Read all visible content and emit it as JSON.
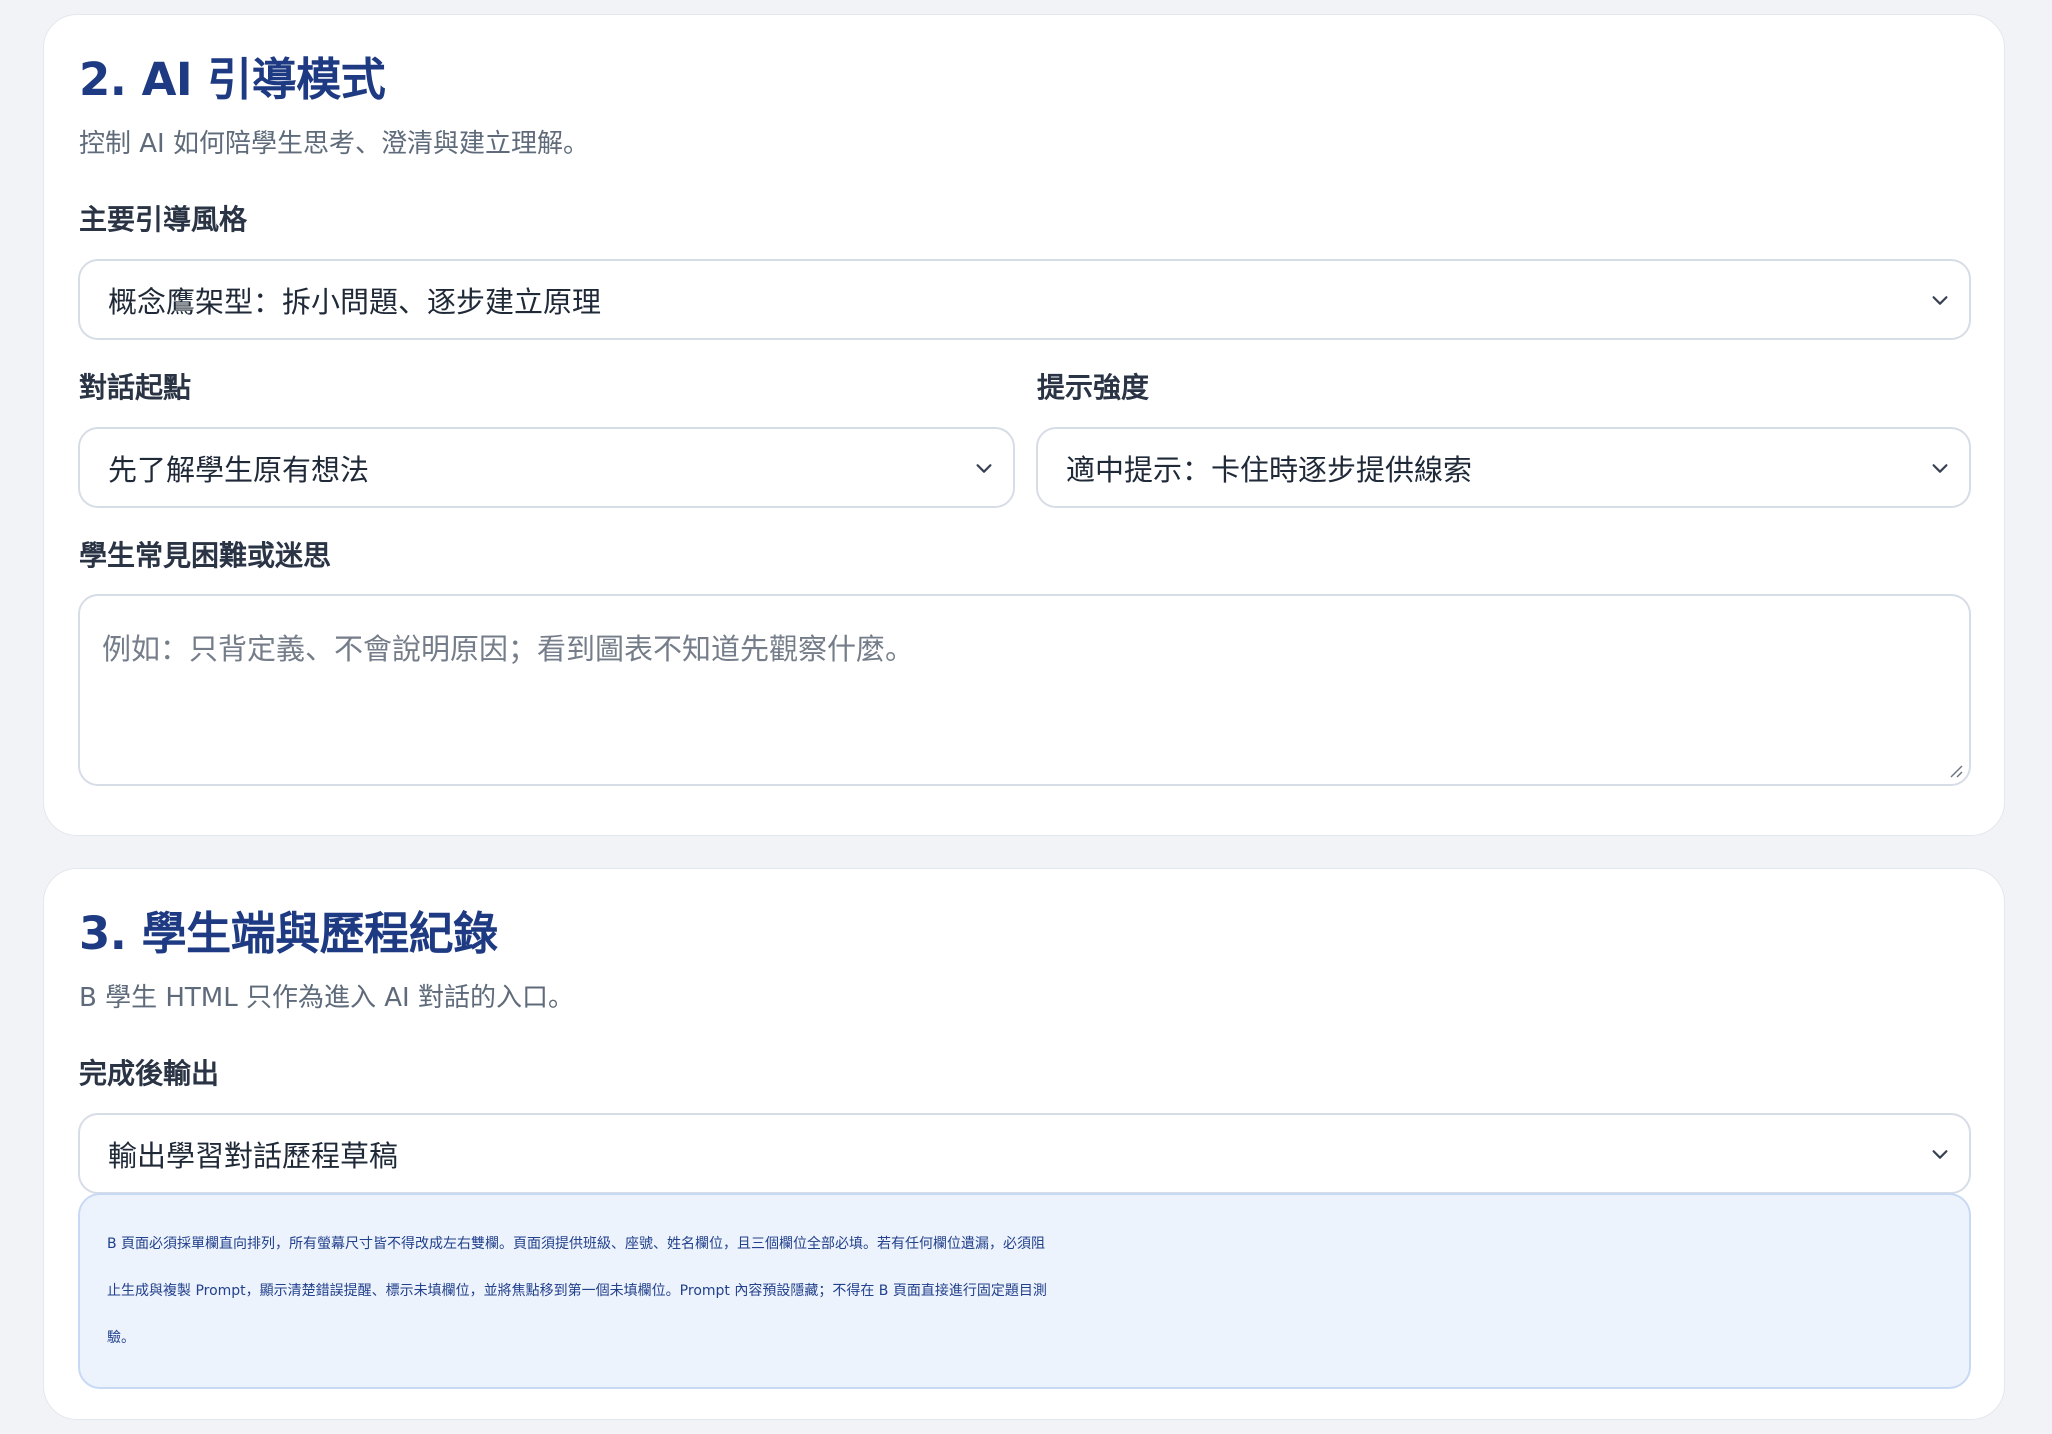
{
  "section2": {
    "title": "2. AI 引導模式",
    "description": "控制 AI 如何陪學生思考、澄清與建立理解。",
    "guidance_style": {
      "label": "主要引導風格",
      "value": "概念鷹架型：拆小問題、逐步建立原理"
    },
    "dialog_start": {
      "label": "對話起點",
      "value": "先了解學生原有想法"
    },
    "hint_strength": {
      "label": "提示強度",
      "value": "適中提示：卡住時逐步提供線索"
    },
    "misconceptions": {
      "label": "學生常見困難或迷思",
      "placeholder": "例如：只背定義、不會說明原因；看到圖表不知道先觀察什麼。",
      "value": ""
    }
  },
  "section3": {
    "title": "3. 學生端與歷程紀錄",
    "description": "B 學生 HTML 只作為進入 AI 對話的入口。",
    "output_after": {
      "label": "完成後輸出",
      "value": "輸出學習對話歷程草稿"
    },
    "info_lines": [
      "B 頁面必須採單欄直向排列，所有螢幕尺寸皆不得改成左右雙欄。頁面須提供班級、座號、姓名欄位，且三個欄位全部必填。若有任何欄位遺漏，必須阻",
      "止生成與複製 Prompt，顯示清楚錯誤提醒、標示未填欄位，並將焦點移到第一個未填欄位。Prompt 內容預設隱藏；不得在 B 頁面直接進行固定題目測",
      "驗。"
    ]
  },
  "icons": {
    "select_arrow": "chevron-down-icon",
    "textarea_resize": "resize-handle-icon"
  },
  "colors": {
    "page_background": "#f1f3f7",
    "card_background": "#ffffff",
    "title": "#1d3a82",
    "info_background": "#edf3fd",
    "info_text": "#22418c"
  }
}
